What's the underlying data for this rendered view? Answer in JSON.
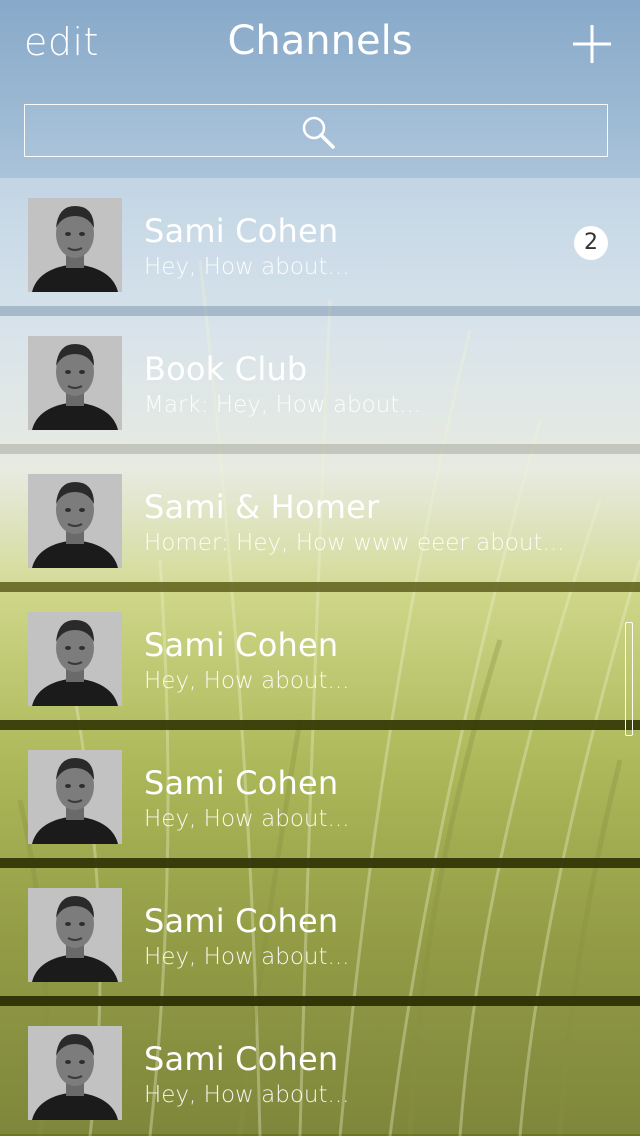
{
  "header": {
    "edit_label": "edit",
    "title": "Channels",
    "add_icon": "plus-icon"
  },
  "search": {
    "placeholder": "",
    "value": "",
    "icon": "search-icon"
  },
  "channels": [
    {
      "name": "Sami Cohen",
      "preview": "Hey, How about...",
      "badge": "2",
      "avatar": "person-avatar"
    },
    {
      "name": "Book Club",
      "preview": "Mark:  Hey, How about...",
      "badge": "",
      "avatar": "person-avatar"
    },
    {
      "name": "Sami & Homer",
      "preview": "Homer: Hey, How www eeer about...",
      "badge": "",
      "avatar": "person-avatar"
    },
    {
      "name": "Sami Cohen",
      "preview": "Hey, How about...",
      "badge": "",
      "avatar": "person-avatar"
    },
    {
      "name": "Sami Cohen",
      "preview": "Hey, How about...",
      "badge": "",
      "avatar": "person-avatar"
    },
    {
      "name": "Sami Cohen",
      "preview": "Hey, How about...",
      "badge": "",
      "avatar": "person-avatar"
    },
    {
      "name": "Sami Cohen",
      "preview": "Hey, How about...",
      "badge": "",
      "avatar": "person-avatar"
    }
  ],
  "colors": {
    "text": "#ffffff",
    "badge_bg": "#ffffff",
    "badge_text": "#333333"
  }
}
